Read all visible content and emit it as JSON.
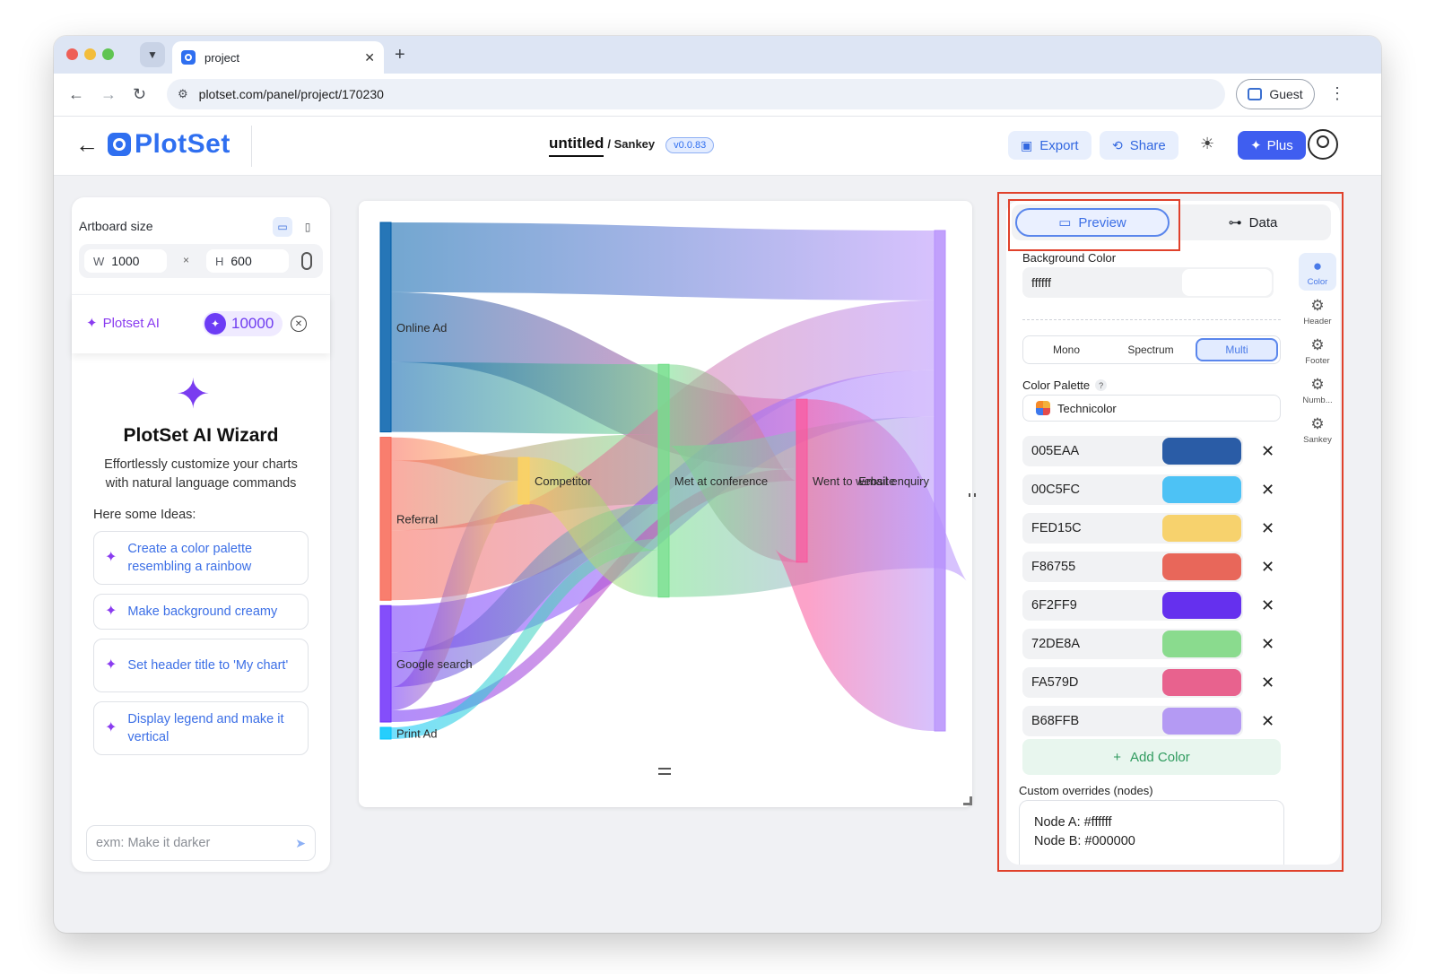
{
  "browser": {
    "tab_title": "project",
    "url": "plotset.com/panel/project/170230",
    "profile": "Guest"
  },
  "header": {
    "logo_text": "PlotSet",
    "project_name": "untitled",
    "project_type": "/ Sankey",
    "version": "v0.0.83",
    "export_label": "Export",
    "share_label": "Share",
    "plus_label": "Plus"
  },
  "left": {
    "artboard_label": "Artboard size",
    "width_label": "W",
    "width_value": "1000",
    "times": "×",
    "height_label": "H",
    "height_value": "600",
    "ai_label": "Plotset AI",
    "credits": "10000",
    "wizard_title": "PlotSet AI Wizard",
    "wizard_desc": "Effortlessly customize your charts with natural language commands",
    "ideas_label": "Here some Ideas:",
    "ideas": [
      "Create a color palette resembling a rainbow",
      "Make background creamy",
      "Set header title to 'My chart'",
      "Display legend and make it vertical"
    ],
    "input_placeholder": "exm: Make it darker"
  },
  "chart_data": {
    "type": "sankey",
    "nodes": [
      "Online Ad",
      "Referral",
      "Google search",
      "Print Ad",
      "Competitor",
      "Met at conference",
      "Went to website",
      "Email enquiry"
    ],
    "node_colors": [
      "#005EAA",
      "#F86755",
      "#6F2FF9",
      "#00C5FC",
      "#FED15C",
      "#72DE8A",
      "#FA579D",
      "#B68FFB"
    ],
    "links": [
      {
        "source": "Online Ad",
        "target": "Email enquiry",
        "value": 6
      },
      {
        "source": "Online Ad",
        "target": "Went to website",
        "value": 6
      },
      {
        "source": "Online Ad",
        "target": "Met at conference",
        "value": 6
      },
      {
        "source": "Referral",
        "target": "Competitor",
        "value": 2
      },
      {
        "source": "Referral",
        "target": "Met at conference",
        "value": 6
      },
      {
        "source": "Referral",
        "target": "Email enquiry",
        "value": 6
      },
      {
        "source": "Google search",
        "target": "Email enquiry",
        "value": 4
      },
      {
        "source": "Google search",
        "target": "Met at conference",
        "value": 3
      },
      {
        "source": "Google search",
        "target": "Competitor",
        "value": 2
      },
      {
        "source": "Google search",
        "target": "Went to website",
        "value": 1
      },
      {
        "source": "Print Ad",
        "target": "Met at conference",
        "value": 1
      },
      {
        "source": "Competitor",
        "target": "Met at conference",
        "value": 4
      },
      {
        "source": "Met at conference",
        "target": "Went to website",
        "value": 7
      },
      {
        "source": "Met at conference",
        "target": "Email enquiry",
        "value": 13
      },
      {
        "source": "Went to website",
        "target": "Email enquiry",
        "value": 14
      }
    ]
  },
  "right": {
    "tab_preview": "Preview",
    "tab_data": "Data",
    "bg_label": "Background Color",
    "bg_value": "ffffff",
    "modes": [
      "Mono",
      "Spectrum",
      "Multi"
    ],
    "active_mode": "Multi",
    "palette_label": "Color Palette",
    "palette_help": "?",
    "palette_value": "Technicolor",
    "colors": [
      "005EAA",
      "00C5FC",
      "FED15C",
      "F86755",
      "6F2FF9",
      "72DE8A",
      "FA579D",
      "B68FFB"
    ],
    "remove_symbol": "✕",
    "add_color": "Add Color",
    "overrides_label": "Custom overrides (nodes)",
    "overrides": [
      "Node A: #ffffff",
      "Node B: #000000"
    ],
    "rail": [
      "Color",
      "Header",
      "Footer",
      "Numb...",
      "Sankey"
    ]
  }
}
